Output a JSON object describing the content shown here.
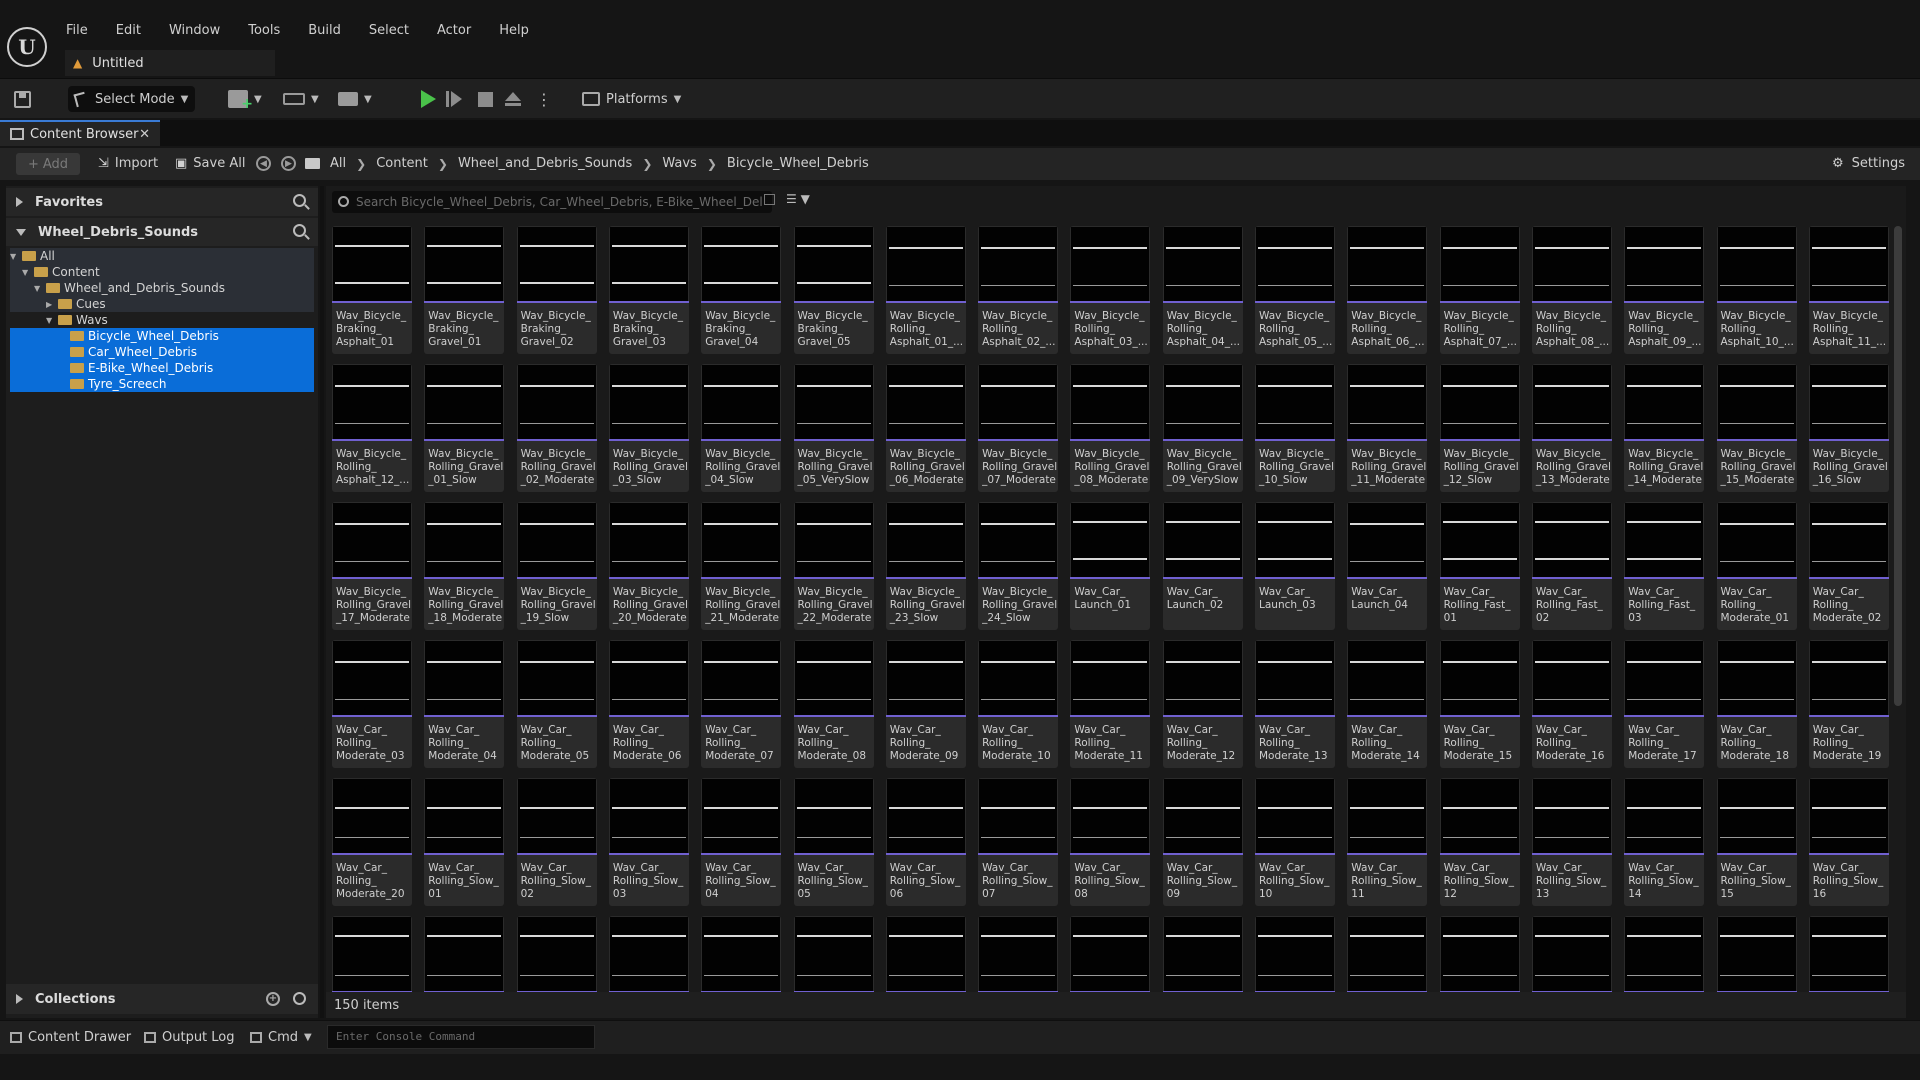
{
  "menu": {
    "items": [
      "File",
      "Edit",
      "Window",
      "Tools",
      "Build",
      "Select",
      "Actor",
      "Help"
    ]
  },
  "doc_tab": {
    "title": "Untitled"
  },
  "toolbar": {
    "mode_label": "Select Mode",
    "platforms_label": "Platforms"
  },
  "content_browser": {
    "tab_label": "Content Browser",
    "add_label": "Add",
    "import_label": "Import",
    "save_all_label": "Save All",
    "breadcrumb": [
      "All",
      "Content",
      "Wheel_and_Debris_Sounds",
      "Wavs",
      "Bicycle_Wheel_Debris"
    ],
    "settings_label": "Settings",
    "search_placeholder": "Search Bicycle_Wheel_Debris, Car_Wheel_Debris, E-Bike_Wheel_Del",
    "favorites_label": "Favorites",
    "sources_label": "Wheel_Debris_Sounds",
    "tree": [
      {
        "label": "All",
        "depth": 0,
        "expanded": true,
        "selected": false
      },
      {
        "label": "Content",
        "depth": 1,
        "expanded": true,
        "selected": false
      },
      {
        "label": "Wheel_and_Debris_Sounds",
        "depth": 2,
        "expanded": true,
        "selected": false
      },
      {
        "label": "Cues",
        "depth": 3,
        "expanded": false,
        "selected": false
      },
      {
        "label": "Wavs",
        "depth": 3,
        "expanded": true,
        "selected": false
      },
      {
        "label": "Bicycle_Wheel_Debris",
        "depth": 4,
        "expanded": false,
        "selected": true
      },
      {
        "label": "Car_Wheel_Debris",
        "depth": 4,
        "expanded": false,
        "selected": true
      },
      {
        "label": "E-Bike_Wheel_Debris",
        "depth": 4,
        "expanded": false,
        "selected": true
      },
      {
        "label": "Tyre_Screech",
        "depth": 4,
        "expanded": false,
        "selected": true
      }
    ],
    "collections_label": "Collections",
    "item_count": "150 items",
    "assets": [
      "Wav_Bicycle_\nBraking_\nAsphalt_01",
      "Wav_Bicycle_\nBraking_\nGravel_01",
      "Wav_Bicycle_\nBraking_\nGravel_02",
      "Wav_Bicycle_\nBraking_\nGravel_03",
      "Wav_Bicycle_\nBraking_\nGravel_04",
      "Wav_Bicycle_\nBraking_\nGravel_05",
      "Wav_Bicycle_\nRolling_\nAsphalt_01_...",
      "Wav_Bicycle_\nRolling_\nAsphalt_02_...",
      "Wav_Bicycle_\nRolling_\nAsphalt_03_...",
      "Wav_Bicycle_\nRolling_\nAsphalt_04_...",
      "Wav_Bicycle_\nRolling_\nAsphalt_05_...",
      "Wav_Bicycle_\nRolling_\nAsphalt_06_...",
      "Wav_Bicycle_\nRolling_\nAsphalt_07_...",
      "Wav_Bicycle_\nRolling_\nAsphalt_08_...",
      "Wav_Bicycle_\nRolling_\nAsphalt_09_...",
      "Wav_Bicycle_\nRolling_\nAsphalt_10_...",
      "Wav_Bicycle_\nRolling_\nAsphalt_11_...",
      "Wav_Bicycle_\nRolling_\nAsphalt_12_...",
      "Wav_Bicycle_\nRolling_Gravel\n_01_Slow",
      "Wav_Bicycle_\nRolling_Gravel\n_02_Moderate",
      "Wav_Bicycle_\nRolling_Gravel\n_03_Slow",
      "Wav_Bicycle_\nRolling_Gravel\n_04_Slow",
      "Wav_Bicycle_\nRolling_Gravel\n_05_VerySlow",
      "Wav_Bicycle_\nRolling_Gravel\n_06_Moderate",
      "Wav_Bicycle_\nRolling_Gravel\n_07_Moderate",
      "Wav_Bicycle_\nRolling_Gravel\n_08_Moderate",
      "Wav_Bicycle_\nRolling_Gravel\n_09_VerySlow",
      "Wav_Bicycle_\nRolling_Gravel\n_10_Slow",
      "Wav_Bicycle_\nRolling_Gravel\n_11_Moderate",
      "Wav_Bicycle_\nRolling_Gravel\n_12_Slow",
      "Wav_Bicycle_\nRolling_Gravel\n_13_Moderate",
      "Wav_Bicycle_\nRolling_Gravel\n_14_Moderate",
      "Wav_Bicycle_\nRolling_Gravel\n_15_Moderate",
      "Wav_Bicycle_\nRolling_Gravel\n_16_Slow",
      "Wav_Bicycle_\nRolling_Gravel\n_17_Moderate",
      "Wav_Bicycle_\nRolling_Gravel\n_18_Moderate",
      "Wav_Bicycle_\nRolling_Gravel\n_19_Slow",
      "Wav_Bicycle_\nRolling_Gravel\n_20_Moderate",
      "Wav_Bicycle_\nRolling_Gravel\n_21_Moderate",
      "Wav_Bicycle_\nRolling_Gravel\n_22_Moderate",
      "Wav_Bicycle_\nRolling_Gravel\n_23_Slow",
      "Wav_Bicycle_\nRolling_Gravel\n_24_Slow",
      "Wav_Car_\nLaunch_01",
      "Wav_Car_\nLaunch_02",
      "Wav_Car_\nLaunch_03",
      "Wav_Car_\nLaunch_04",
      "Wav_Car_\nRolling_Fast_\n01",
      "Wav_Car_\nRolling_Fast_\n02",
      "Wav_Car_\nRolling_Fast_\n03",
      "Wav_Car_\nRolling_\nModerate_01",
      "Wav_Car_\nRolling_\nModerate_02",
      "Wav_Car_\nRolling_\nModerate_03",
      "Wav_Car_\nRolling_\nModerate_04",
      "Wav_Car_\nRolling_\nModerate_05",
      "Wav_Car_\nRolling_\nModerate_06",
      "Wav_Car_\nRolling_\nModerate_07",
      "Wav_Car_\nRolling_\nModerate_08",
      "Wav_Car_\nRolling_\nModerate_09",
      "Wav_Car_\nRolling_\nModerate_10",
      "Wav_Car_\nRolling_\nModerate_11",
      "Wav_Car_\nRolling_\nModerate_12",
      "Wav_Car_\nRolling_\nModerate_13",
      "Wav_Car_\nRolling_\nModerate_14",
      "Wav_Car_\nRolling_\nModerate_15",
      "Wav_Car_\nRolling_\nModerate_16",
      "Wav_Car_\nRolling_\nModerate_17",
      "Wav_Car_\nRolling_\nModerate_18",
      "Wav_Car_\nRolling_\nModerate_19",
      "Wav_Car_\nRolling_\nModerate_20",
      "Wav_Car_\nRolling_Slow_\n01",
      "Wav_Car_\nRolling_Slow_\n02",
      "Wav_Car_\nRolling_Slow_\n03",
      "Wav_Car_\nRolling_Slow_\n04",
      "Wav_Car_\nRolling_Slow_\n05",
      "Wav_Car_\nRolling_Slow_\n06",
      "Wav_Car_\nRolling_Slow_\n07",
      "Wav_Car_\nRolling_Slow_\n08",
      "Wav_Car_\nRolling_Slow_\n09",
      "Wav_Car_\nRolling_Slow_\n10",
      "Wav_Car_\nRolling_Slow_\n11",
      "Wav_Car_\nRolling_Slow_\n12",
      "Wav_Car_\nRolling_Slow_\n13",
      "Wav_Car_\nRolling_Slow_\n14",
      "Wav_Car_\nRolling_Slow_\n15",
      "Wav_Car_\nRolling_Slow_\n16"
    ],
    "partial_row_tiles": 17
  },
  "bottom_bar": {
    "content_drawer_label": "Content Drawer",
    "output_log_label": "Output Log",
    "cmd_label": "Cmd",
    "console_placeholder": "Enter Console Command"
  }
}
